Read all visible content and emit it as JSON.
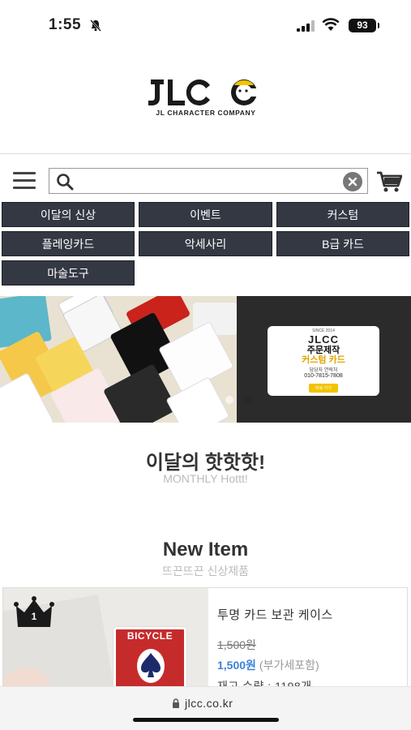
{
  "status_bar": {
    "time": "1:55",
    "battery": "93"
  },
  "logo": {
    "wordmark": "JLCC",
    "subtitle": "JL CHARACTER COMPANY"
  },
  "search": {
    "value": "",
    "placeholder": ""
  },
  "categories": [
    {
      "label": "이달의 신상"
    },
    {
      "label": "이벤트"
    },
    {
      "label": "커스텀"
    },
    {
      "label": "플레잉카드"
    },
    {
      "label": "악세사리"
    },
    {
      "label": "B급 카드"
    },
    {
      "label": "마술도구"
    }
  ],
  "banner": {
    "promo": {
      "since": "SINCE 2014",
      "brand": "JLCC",
      "line1": "주문제작",
      "line2": "커스텀 카드",
      "contact_label": "담당자 연락처",
      "phone": "010-7815-7808",
      "button": "바로 가기"
    }
  },
  "section_monthly": {
    "title": "이달의 핫핫핫!",
    "subtitle": "MONTHLY Hottt!"
  },
  "section_new": {
    "title": "New Item",
    "subtitle": "뜨끈뜨끈 신상제품"
  },
  "product": {
    "rank": "1",
    "image_label": "BICYCLE",
    "name": "투명 카드 보관 케이스",
    "original_price": "1,500원",
    "price": "1,500원",
    "vat_note": "(부가세포함)",
    "stock_label": "재고 수량",
    "stock_value": "1198개"
  },
  "url_bar": {
    "url": "jlcc.co.kr"
  },
  "colors": {
    "category_bg": "#333843",
    "price": "#3a83d8",
    "accent": "#f3c300"
  }
}
